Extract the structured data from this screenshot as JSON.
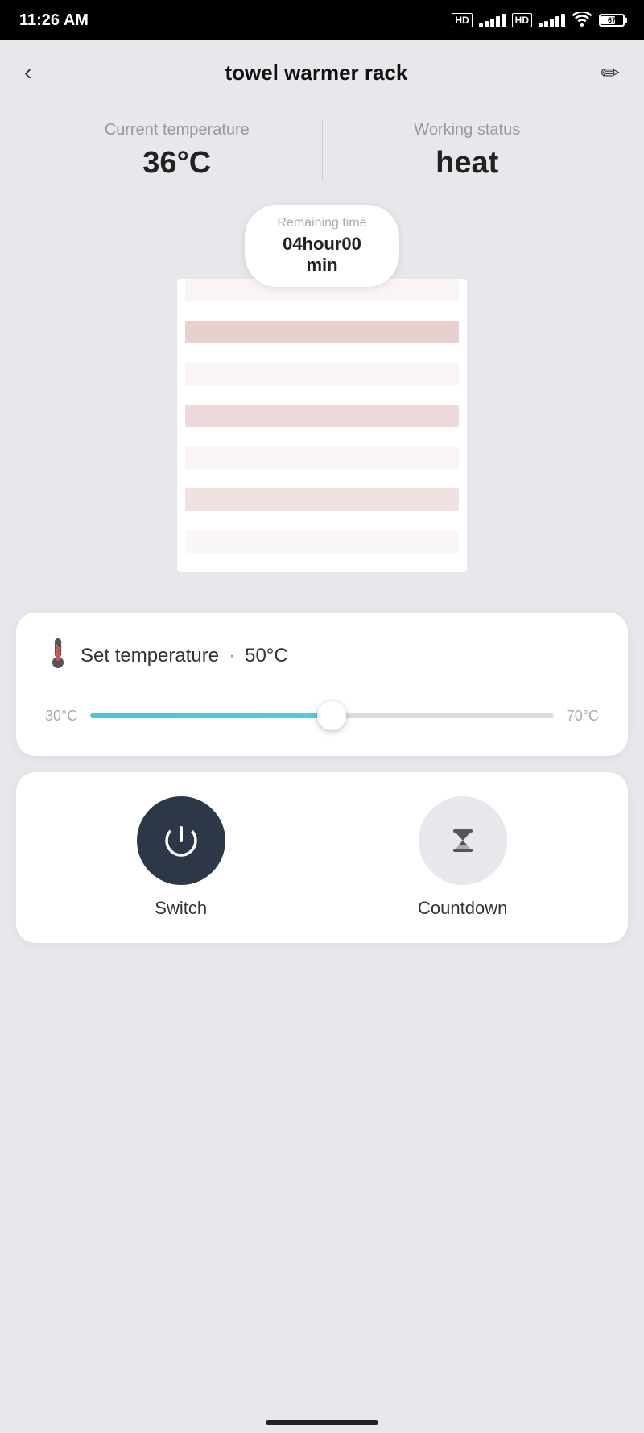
{
  "statusBar": {
    "time": "11:26 AM",
    "batteryLevel": "67"
  },
  "header": {
    "title": "towel warmer rack",
    "backLabel": "‹",
    "editLabel": "✏"
  },
  "deviceInfo": {
    "currentTempLabel": "Current temperature",
    "currentTempValue": "36°C",
    "workingStatusLabel": "Working status",
    "workingStatusValue": "heat",
    "remainingTimeLabel": "Remaining time",
    "remainingTimeValue": "04hour00",
    "remainingTimeUnit": "min"
  },
  "temperatureControl": {
    "icon": "🌡",
    "label": "Set temperature",
    "dot": "·",
    "value": "50°C",
    "minTemp": "30°C",
    "maxTemp": "70°C",
    "sliderPercent": 52
  },
  "controls": {
    "switch": {
      "label": "Switch"
    },
    "countdown": {
      "label": "Countdown"
    }
  }
}
